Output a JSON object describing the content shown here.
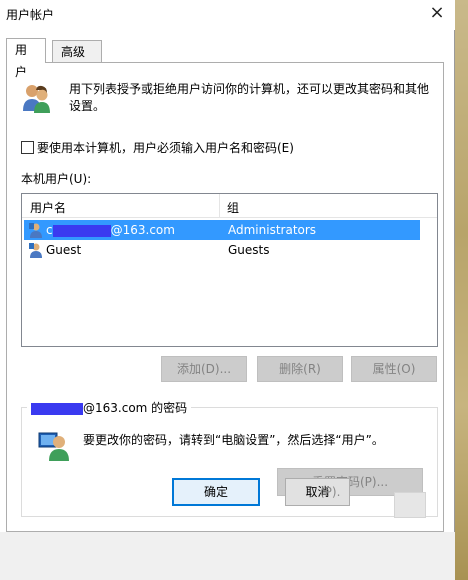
{
  "window": {
    "title": "用户帐户",
    "close_glyph": "×"
  },
  "tabs": [
    {
      "label": "用户",
      "active": true
    },
    {
      "label": "高级",
      "active": false
    }
  ],
  "intro": {
    "icon": "users-icon",
    "text": "用下列表授予或拒绝用户访问你的计算机，还可以更改其密码和其他设置。"
  },
  "require_login": {
    "checked": false,
    "label": "要使用本计算机，用户必须输入用户名和密码(E)"
  },
  "local_users": {
    "label": "本机用户(U):",
    "columns": [
      "用户名",
      "组"
    ],
    "rows": [
      {
        "name_prefix": "c",
        "name_suffix": "@163.com",
        "group": "Administrators",
        "selected": true
      },
      {
        "name_prefix": "",
        "name_suffix": "Guest",
        "group": "Guests",
        "selected": false
      }
    ]
  },
  "list_buttons": {
    "add": "添加(D)...",
    "remove": "删除(R)",
    "properties": "属性(O)"
  },
  "password_group": {
    "legend_suffix": "@163.com 的密码",
    "message": "要更改你的密码，请转到“电脑设置”，然后选择“用户”。",
    "reset_button": "重置密码(P)..."
  },
  "footer": {
    "ok": "确定",
    "cancel": "取消",
    "apply_fragment": "(P)."
  },
  "colors": {
    "selection": "#3399ff",
    "redaction": "#3a3af0",
    "ok_border": "#0078d7"
  }
}
